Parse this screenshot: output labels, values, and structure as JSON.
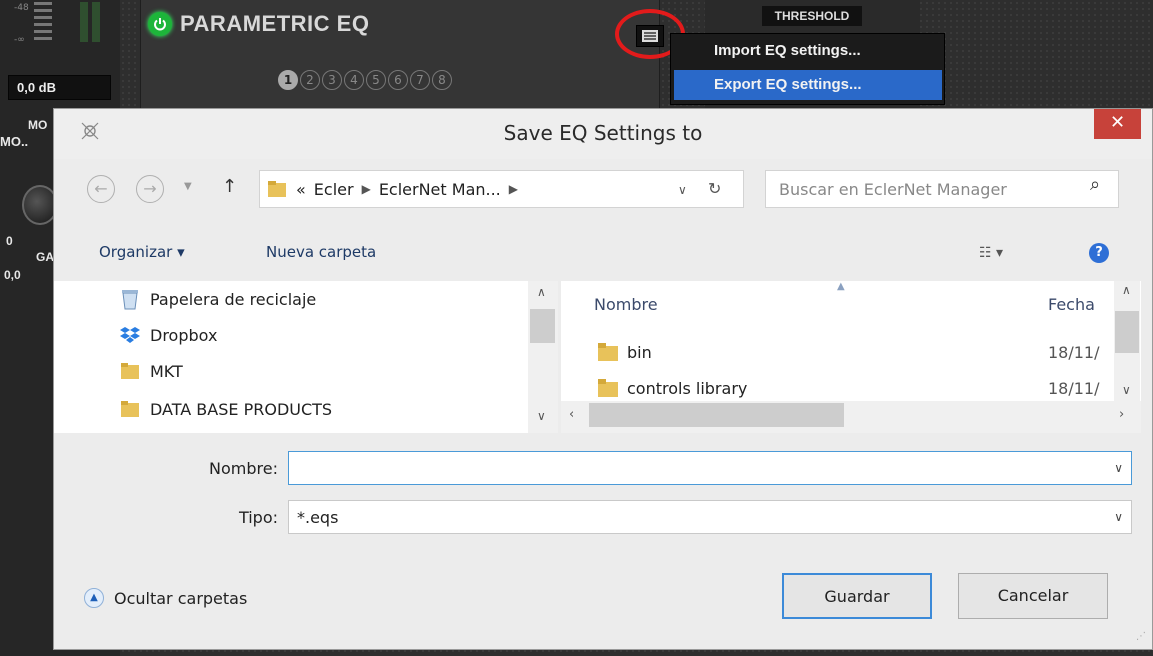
{
  "background_app": {
    "gain_value": "0,0 dB",
    "eq_title": "PARAMETRIC EQ",
    "bands": [
      "1",
      "2",
      "3",
      "4",
      "5",
      "6",
      "7",
      "8"
    ],
    "threshold_label": "THRESHOLD",
    "side_labels": [
      "MO",
      "MO..",
      "0",
      "GA",
      "0,0"
    ],
    "context_menu": {
      "import_label": "Import EQ settings...",
      "export_label": "Export EQ settings..."
    },
    "colors": {
      "power": "#1db53a",
      "highlight": "#2a69c9",
      "annotation_circle": "#e21b1b"
    }
  },
  "dialog": {
    "title": "Save EQ Settings to",
    "close_label": "✕",
    "address": {
      "prefix": "«",
      "crumbs": [
        "Ecler",
        "EclerNet Man..."
      ]
    },
    "search": {
      "placeholder": "Buscar en EclerNet Manager"
    },
    "commands": {
      "organize": "Organizar ▾",
      "new_folder": "Nueva carpeta"
    },
    "nav_pane": [
      {
        "label": "Papelera de reciclaje",
        "icon": "recycle-bin-icon"
      },
      {
        "label": "Dropbox",
        "icon": "dropbox-icon"
      },
      {
        "label": "MKT",
        "icon": "folder-icon"
      },
      {
        "label": "DATA BASE PRODUCTS",
        "icon": "folder-icon"
      }
    ],
    "file_pane": {
      "columns": [
        "Nombre",
        "Fecha"
      ],
      "rows": [
        {
          "name": "bin",
          "date": "18/11/"
        },
        {
          "name": "controls library",
          "date": "18/11/"
        }
      ]
    },
    "form": {
      "name_label": "Nombre:",
      "name_value": "",
      "type_label": "Tipo:",
      "type_value": "*.eqs"
    },
    "hide_folders_label": "Ocultar carpetas",
    "save_label": "Guardar",
    "cancel_label": "Cancelar"
  }
}
